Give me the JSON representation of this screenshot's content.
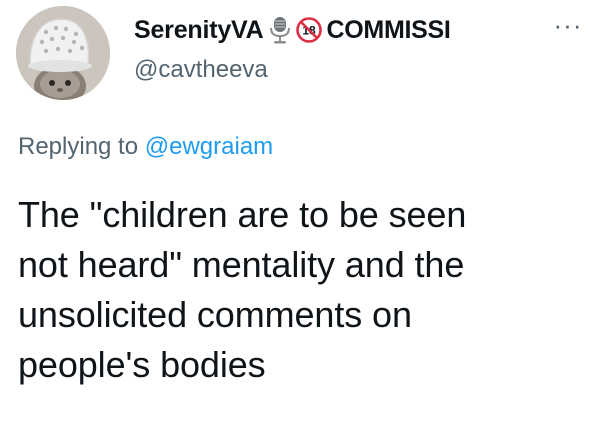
{
  "tweet": {
    "author": {
      "display_name": "SerenityVA",
      "emoji_1": "studio-microphone-emoji",
      "emoji_2": "no-one-under-eighteen-emoji",
      "name_suffix": "COMMISSI",
      "handle": "@cavtheeva"
    },
    "more_icon": "more-dots-icon",
    "reply_context": {
      "prefix": "Replying to",
      "mention": "@ewgraiam"
    },
    "body_lines": [
      "The \"children are to be seen",
      "not heard\" mentality and the",
      "unsolicited comments on",
      "people's bodies"
    ]
  },
  "colors": {
    "text_primary": "#0f1419",
    "text_secondary": "#536471",
    "link": "#1d9bf0",
    "background": "#ffffff"
  }
}
